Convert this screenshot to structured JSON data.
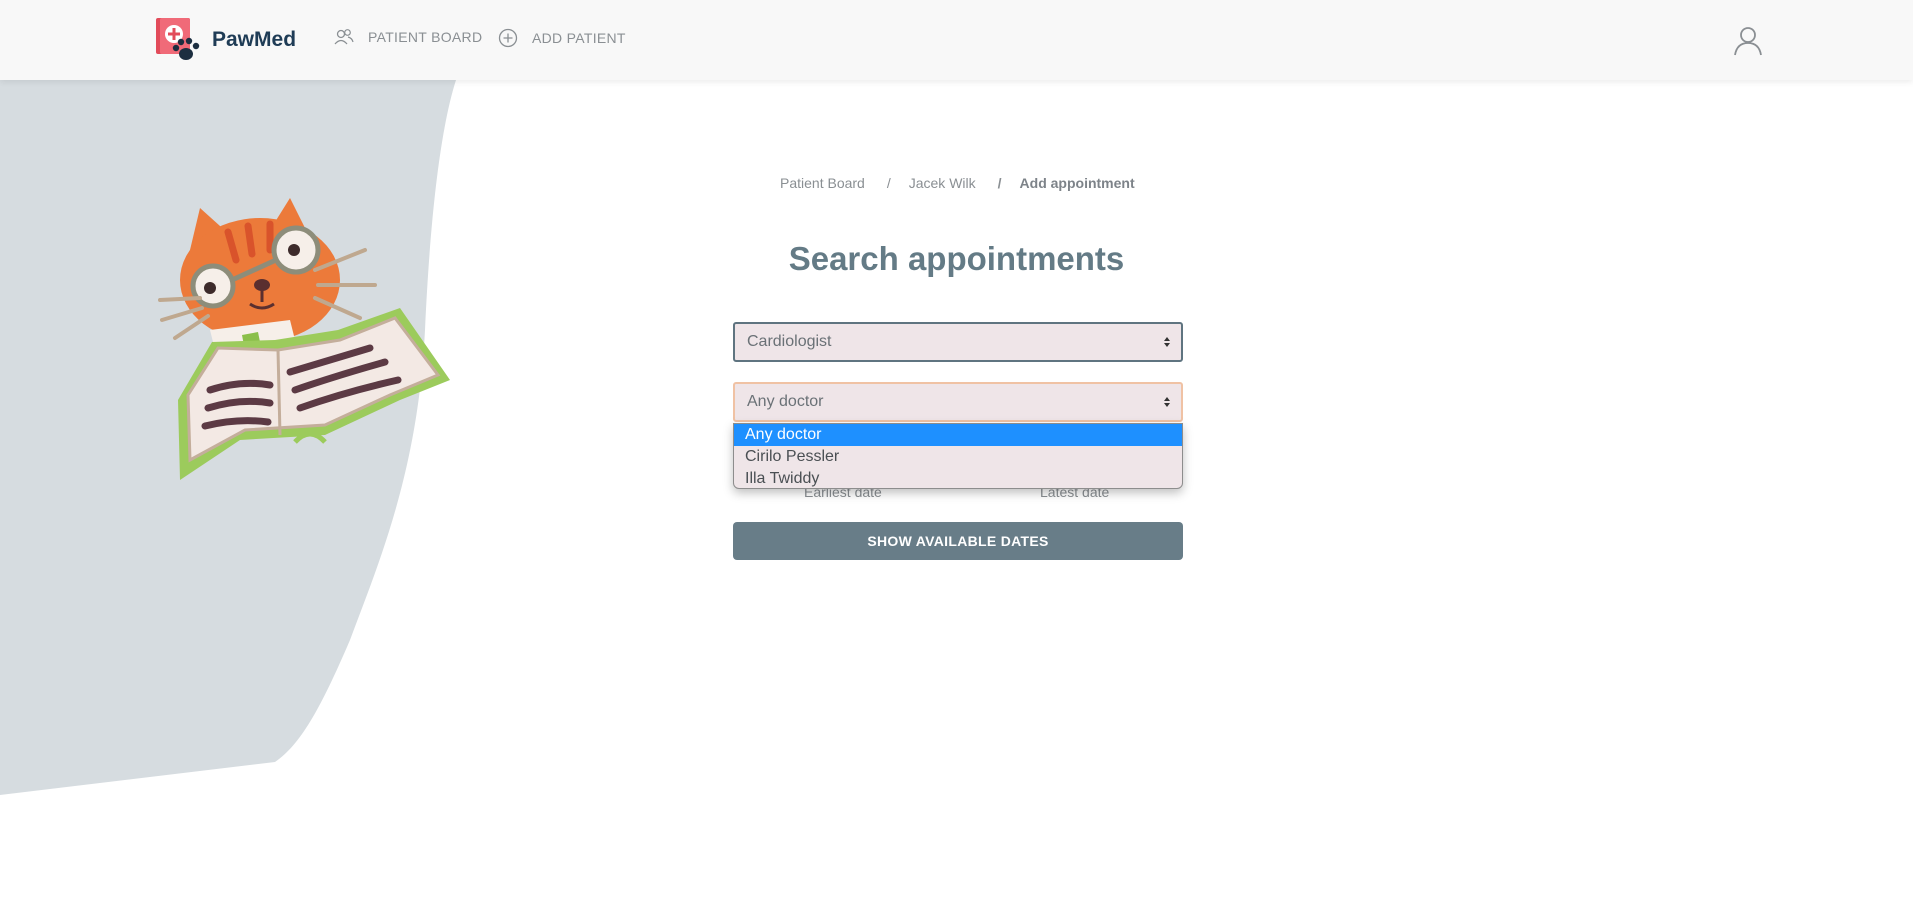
{
  "nav": {
    "brand": "PawMed",
    "patient_board": "PATIENT BOARD",
    "add_patient": "ADD PATIENT"
  },
  "breadcrumb": {
    "items": [
      "Patient Board",
      "Jacek Wilk"
    ],
    "current": "Add appointment",
    "separator": "/"
  },
  "title": "Search appointments",
  "form": {
    "specialty_value": "Cardiologist",
    "doctor_value": "Any doctor",
    "doctor_options": [
      "Any doctor",
      "Cirilo Pessler",
      "Illa Twiddy"
    ],
    "earliest_label": "Earliest date",
    "latest_label": "Latest date",
    "submit_label": "SHOW AVAILABLE DATES"
  },
  "icons": {
    "brand": "pawmed-logo-icon",
    "patient_board": "users-icon",
    "add_patient": "plus-circle-icon",
    "user": "user-icon",
    "select": "select-arrows-icon"
  },
  "colors": {
    "accent": "#687d88",
    "title": "#647b86",
    "brand_text": "#1f3c56",
    "field_bg": "#efe5e8",
    "option_selected": "#1e90ff",
    "focus_border": "#f0c2a4"
  }
}
